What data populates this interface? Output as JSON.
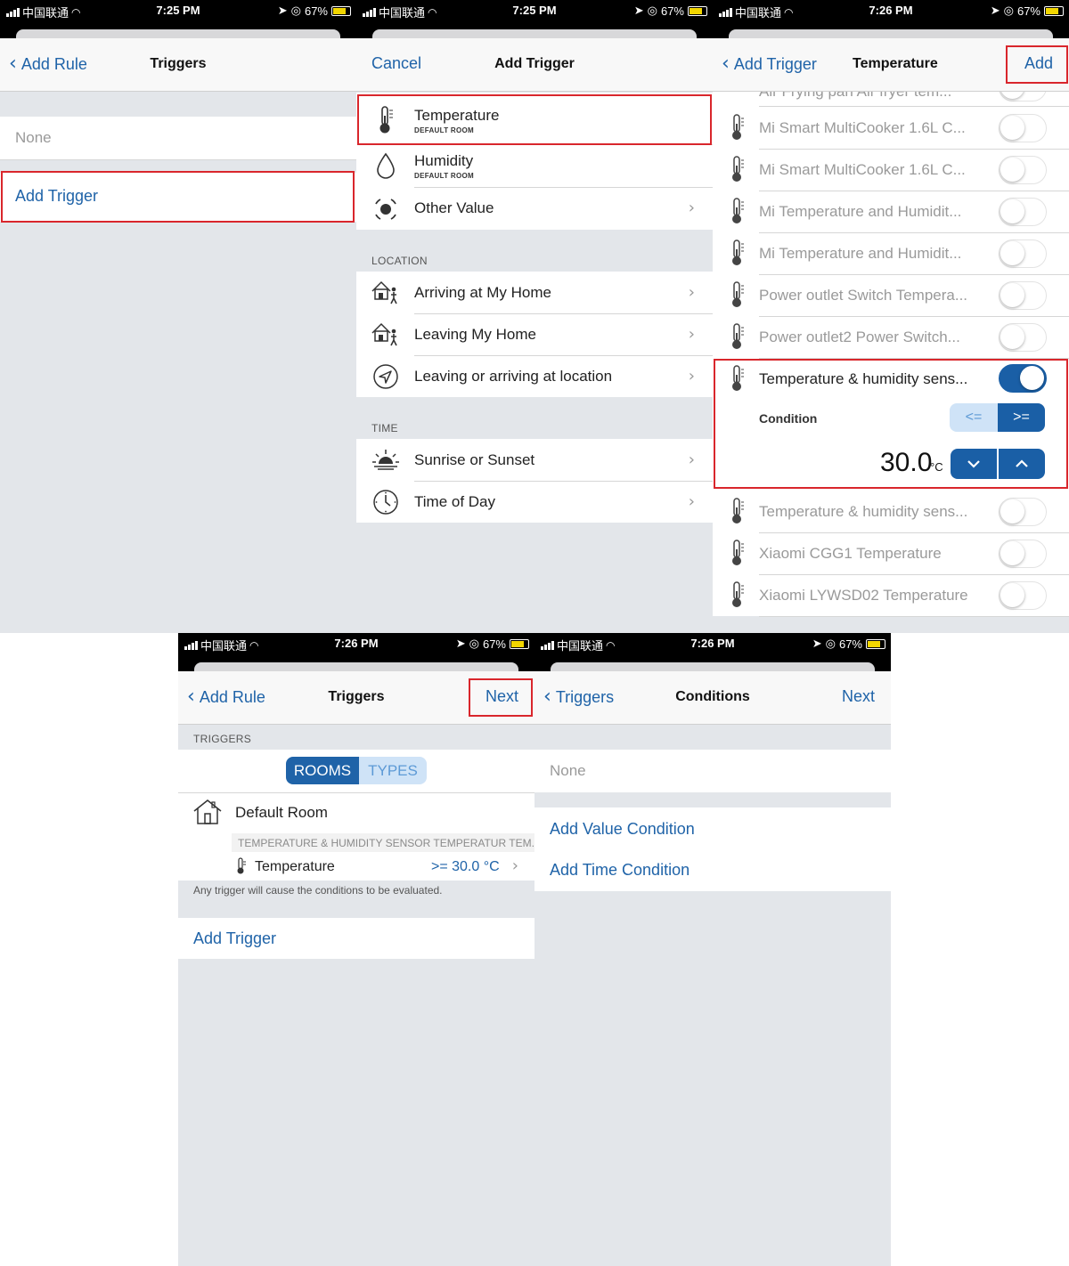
{
  "status": {
    "carrier": "中国联通",
    "battery": "67%",
    "time_p1": "7:25 PM",
    "time_p2": "7:25 PM",
    "time_p3": "7:26 PM",
    "time_p4": "7:26 PM",
    "time_p5": "7:26 PM"
  },
  "p1": {
    "back_label": "Add Rule",
    "title": "Triggers",
    "none_label": "None",
    "add_trigger": "Add Trigger"
  },
  "p2": {
    "cancel_label": "Cancel",
    "title": "Add Trigger",
    "temperature": "Temperature",
    "temperature_sub": "DEFAULT ROOM",
    "humidity": "Humidity",
    "humidity_sub": "DEFAULT ROOM",
    "other_value": "Other Value",
    "location_header": "LOCATION",
    "arriving": "Arriving at My Home",
    "leaving": "Leaving My Home",
    "location_any": "Leaving or arriving at location",
    "time_header": "TIME",
    "sunrise": "Sunrise or Sunset",
    "time_of_day": "Time of Day"
  },
  "p3": {
    "back_label": "Add Trigger",
    "title": "Temperature",
    "add_label": "Add",
    "partial_row": "Air Frying pan Air fryer tem...",
    "devices_above": [
      "Mi Smart MultiCooker 1.6L C...",
      "Mi Smart MultiCooker 1.6L C...",
      "Mi Temperature and Humidit...",
      "Mi Temperature and Humidit...",
      "Power outlet Switch Tempera...",
      "Power outlet2 Power Switch..."
    ],
    "selected_device": "Temperature & humidity sens...",
    "condition_label": "Condition",
    "op_lte": "<=",
    "op_gte": ">=",
    "value": "30.0",
    "unit": "°C",
    "devices_below": [
      "Temperature & humidity sens...",
      "Xiaomi CGG1 Temperature",
      "Xiaomi LYWSD02 Temperature"
    ]
  },
  "p4": {
    "back_label": "Add Rule",
    "title": "Triggers",
    "next_label": "Next",
    "section_header": "TRIGGERS",
    "seg_rooms": "ROOMS",
    "seg_types": "TYPES",
    "room_name": "Default Room",
    "device_path": "TEMPERATURE & HUMIDITY SENSOR TEMPERATUR TEM...",
    "trigger_name": "Temperature",
    "trigger_value": ">= 30.0 °C",
    "footer_note": "Any trigger will cause the conditions to be evaluated.",
    "add_trigger": "Add Trigger"
  },
  "p5": {
    "back_label": "Triggers",
    "title": "Conditions",
    "next_label": "Next",
    "none_label": "None",
    "add_value_condition": "Add Value Condition",
    "add_time_condition": "Add Time Condition"
  },
  "colors": {
    "accent": "#1f63a8",
    "highlight": "#d9262c",
    "toggle_on": "#1a5fa6",
    "background": "#e3e6ea"
  },
  "icons": [
    "thermometer-icon",
    "droplet-icon",
    "target-icon",
    "home-person-icon",
    "location-arrow-icon",
    "sunrise-icon",
    "clock-icon",
    "house-icon",
    "chevron-right-icon",
    "chevron-left-icon",
    "chevron-down-icon",
    "chevron-up-icon"
  ]
}
